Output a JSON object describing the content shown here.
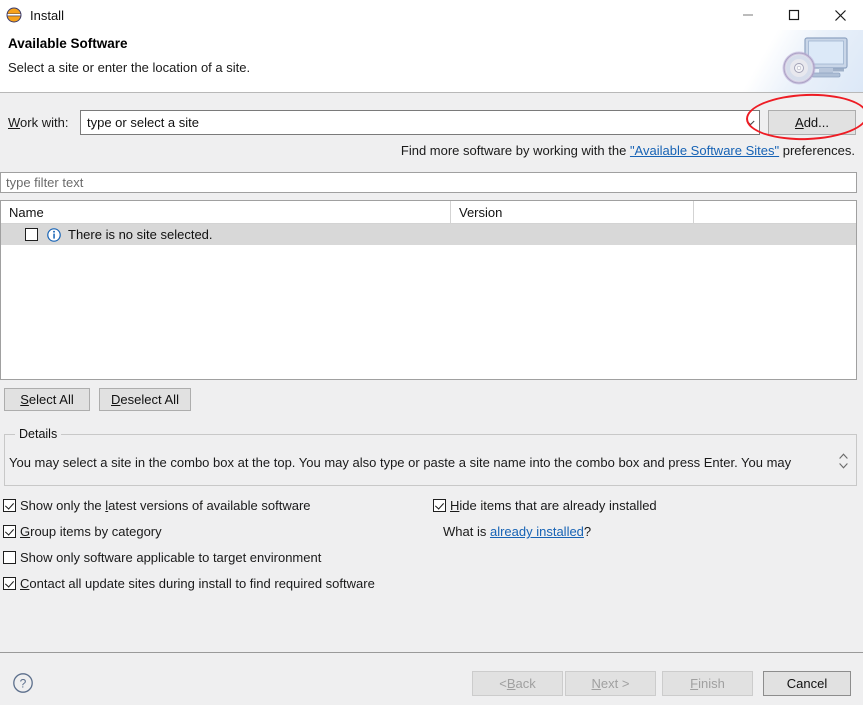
{
  "window": {
    "title": "Install",
    "icon": "eclipse-icon",
    "controls": {
      "minimize": "minimize-icon",
      "maximize": "maximize-icon",
      "close": "close-icon"
    }
  },
  "banner": {
    "title": "Available Software",
    "subtitle": "Select a site or enter the location of a site.",
    "art": "monitor-cd-icon"
  },
  "workwith": {
    "label": "Work with:",
    "label_mnemonic": "W",
    "combo_value": "type or select a site",
    "combo_placeholder": "type or select a site",
    "add_button": "Add...",
    "add_mnemonic": "A",
    "annotation_color": "#ee1c24"
  },
  "findmore": {
    "prefix": "Find more software by working with the ",
    "link": "\"Available Software Sites\"",
    "suffix": " preferences."
  },
  "filter": {
    "placeholder": "type filter text",
    "value": ""
  },
  "table": {
    "columns": [
      "Name",
      "Version",
      ""
    ],
    "rows": [
      {
        "checked": false,
        "icon": "info-icon",
        "name": "There is no site selected.",
        "version": ""
      }
    ]
  },
  "selection_buttons": {
    "select_all": "Select All",
    "select_all_mnemonic": "S",
    "deselect_all": "Deselect All",
    "deselect_all_mnemonic": "D"
  },
  "details": {
    "legend": "Details",
    "text": "You may select a site in the combo box at the top.  You may also type or paste a site name into the combo box and press Enter.  You may",
    "spinner": "scroll-spinner"
  },
  "options": [
    {
      "label": "Show only the latest versions of available software",
      "checked": true,
      "mnemonic_index": 15
    },
    {
      "label": "Group items by category",
      "checked": true,
      "mnemonic_index": 0
    },
    {
      "label": "Show only software applicable to target environment",
      "checked": false,
      "mnemonic_index": -1
    },
    {
      "label": "Contact all update sites during install to find required software",
      "checked": true,
      "mnemonic_index": 0
    }
  ],
  "right_options": {
    "hide_installed": {
      "label": "Hide items that are already installed",
      "checked": true,
      "mnemonic_index": 0
    },
    "whatis_prefix": "What is ",
    "whatis_link": "already installed",
    "whatis_suffix": "?"
  },
  "footer": {
    "help": "help-icon",
    "back": "< Back",
    "back_mnemonic": "B",
    "next": "Next >",
    "next_mnemonic": "N",
    "finish": "Finish",
    "finish_mnemonic": "F",
    "cancel": "Cancel",
    "enabled": [
      "Cancel"
    ],
    "disabled": [
      "< Back",
      "Next >",
      "Finish"
    ]
  },
  "colors": {
    "dialog_bg": "#efeff0",
    "field_bg": "#ffffff",
    "link": "#1763b5",
    "row_selected_bg": "#d8d8d8",
    "annotation": "#ee1c24"
  }
}
